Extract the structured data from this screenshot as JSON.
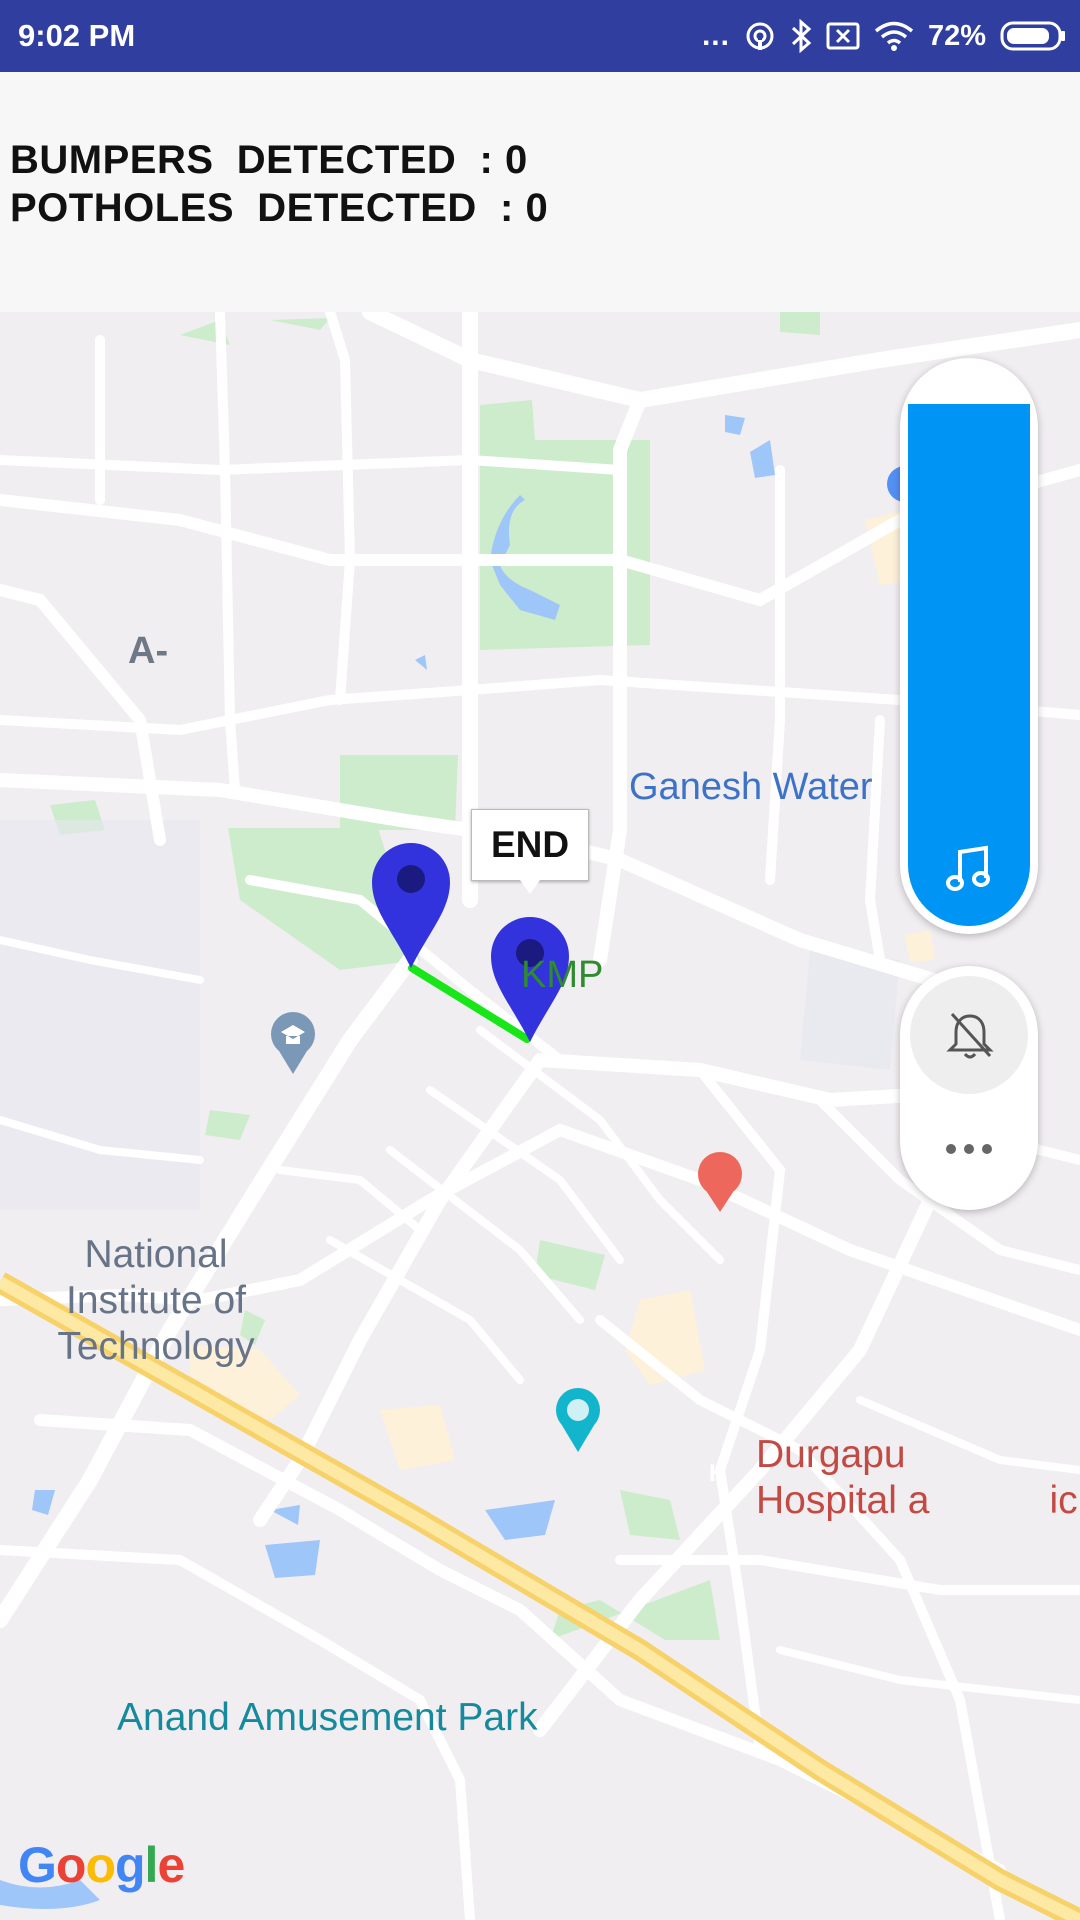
{
  "status_bar": {
    "time": "9:02 PM",
    "battery": "72%",
    "dots": "..."
  },
  "stats": {
    "bumpers": "BUMPERS  DETECTED  : 0",
    "potholes": "POTHOLES  DETECTED  : 0"
  },
  "map": {
    "labels": {
      "a": "A-",
      "ganesh": "Ganesh Water",
      "kmp": "KMP",
      "nit_line1": "National",
      "nit_line2": "Institute of",
      "nit_line3": "Technology",
      "durgapur_line1": "Durgapu",
      "durgapur_line2": "Hospital a",
      "durgapur_tail": "ic",
      "anand": "Anand Amusement Park"
    },
    "end_tooltip": "END",
    "route_color": "#19e619",
    "marker_color": "#3333dd",
    "google_logo": "Google"
  },
  "volume": {
    "accent": "#0095f4"
  }
}
